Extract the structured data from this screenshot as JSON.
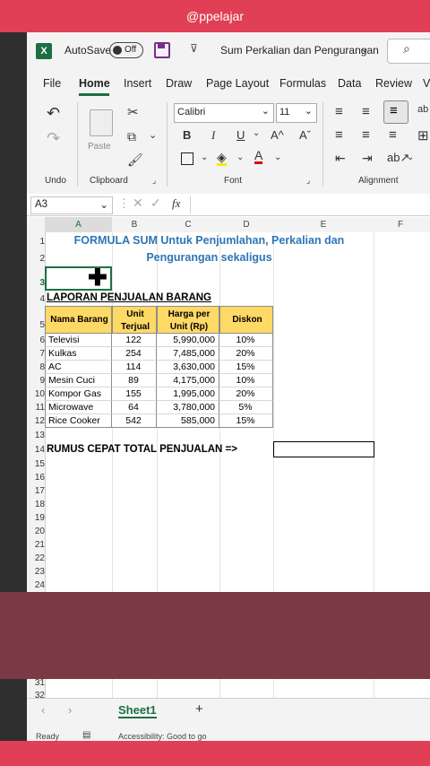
{
  "overlay_user": "@ppelajar",
  "titlebar": {
    "autosave_label": "AutoSave",
    "autosave_state": "Off",
    "doc_title": "Sum Perkalian dan Pengurangan",
    "logo_letter": "X"
  },
  "tabs": [
    "File",
    "Home",
    "Insert",
    "Draw",
    "Page Layout",
    "Formulas",
    "Data",
    "Review",
    "V"
  ],
  "active_tab": "Home",
  "ribbon": {
    "paste_label": "Paste",
    "font_name": "Calibri",
    "font_size": "11",
    "bold": "B",
    "italic": "I",
    "underline": "U",
    "grow_font": "A^",
    "shrink_font": "Aˇ",
    "groups": {
      "undo": "Undo",
      "clipboard": "Clipboard",
      "font": "Font",
      "alignment": "Alignment"
    }
  },
  "formula_bar": {
    "name_box": "A3",
    "fx": "fx"
  },
  "columns": [
    "A",
    "B",
    "C",
    "D",
    "E",
    "F"
  ],
  "rows": {
    "title_line1": "FORMULA SUM Untuk Penjumlahan, Perkalian dan",
    "title_line2": "Pengurangan sekaligus",
    "report_title": "LAPORAN PENJUALAN BARANG",
    "formula_label": "RUMUS CEPAT TOTAL PENJUALAN =>"
  },
  "table": {
    "headers": [
      "Nama Barang",
      "Unit Terjual",
      "Harga per Unit (Rp)",
      "Diskon"
    ],
    "rows": [
      [
        "Televisi",
        "122",
        "5,990,000",
        "10%"
      ],
      [
        "Kulkas",
        "254",
        "7,485,000",
        "20%"
      ],
      [
        "AC",
        "114",
        "3,630,000",
        "15%"
      ],
      [
        "Mesin Cuci",
        "89",
        "4,175,000",
        "10%"
      ],
      [
        "Kompor Gas",
        "155",
        "1,995,000",
        "20%"
      ],
      [
        "Microwave",
        "64",
        "3,780,000",
        "5%"
      ],
      [
        "Rice Cooker",
        "542",
        "585,000",
        "15%"
      ]
    ]
  },
  "row_numbers": [
    "1",
    "2",
    "3",
    "4",
    "5",
    "6",
    "7",
    "8",
    "9",
    "10",
    "11",
    "12",
    "13",
    "14",
    "15",
    "16",
    "17",
    "18",
    "19",
    "20",
    "21",
    "22",
    "23",
    "24",
    "31",
    "32"
  ],
  "sheet_tabs": {
    "active": "Sheet1",
    "add": "+"
  },
  "status": {
    "ready": "Ready",
    "accessibility": "Accessibility: Good to go"
  },
  "colors": {
    "brand_green": "#1d6f42",
    "header_fill": "#ffd966",
    "title_blue": "#2e75b6",
    "overlay": "#7a3a44"
  }
}
